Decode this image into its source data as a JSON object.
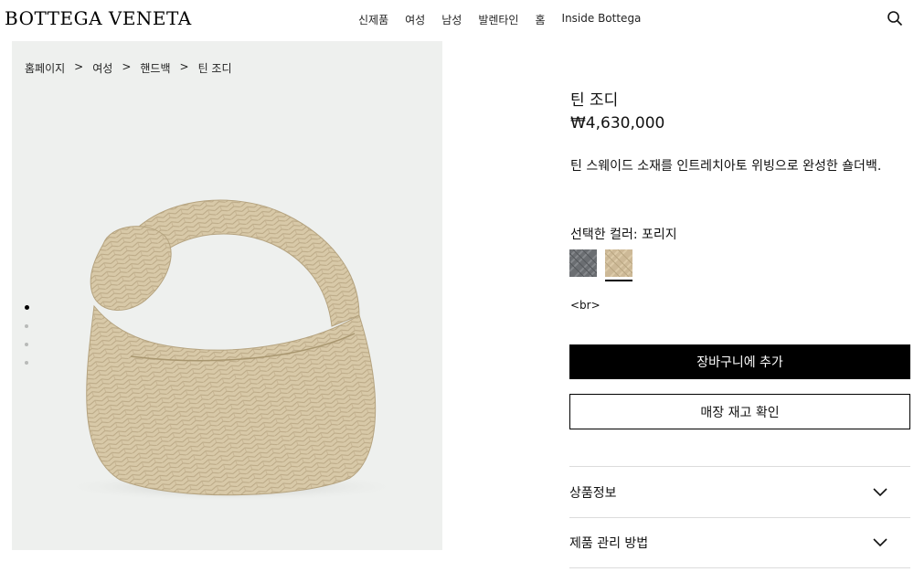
{
  "header": {
    "logo": "BOTTEGA VENETA",
    "nav": [
      "신제품",
      "여성",
      "남성",
      "발렌타인",
      "홈",
      "Inside Bottega"
    ],
    "search_icon": "search-icon"
  },
  "breadcrumb": [
    "홈페이지",
    "여성",
    "핸드백",
    "틴 조디"
  ],
  "breadcrumb_separator": ">",
  "gallery": {
    "image_count": 4,
    "active_index": 0
  },
  "product": {
    "title": "틴 조디",
    "price": "₩4,630,000",
    "description": "틴 스웨이드 소재를 인트레치아토 위빙으로 완성한 숄더백.",
    "color_label": "선택한 컬러: 포리지",
    "swatches": [
      {
        "name": "grey",
        "color": "#6b6e72",
        "selected": false
      },
      {
        "name": "porridge",
        "color": "#cdb997",
        "selected": true
      }
    ],
    "stray_text": "<br>"
  },
  "actions": {
    "add_to_cart": "장바구니에 추가",
    "check_stock": "매장 재고 확인"
  },
  "accordion": [
    {
      "label": "상품정보"
    },
    {
      "label": "제품 관리 방법"
    }
  ],
  "colors": {
    "panel_bg": "#eef0ee",
    "bag": "#d8c9a8",
    "button": "#000000"
  }
}
